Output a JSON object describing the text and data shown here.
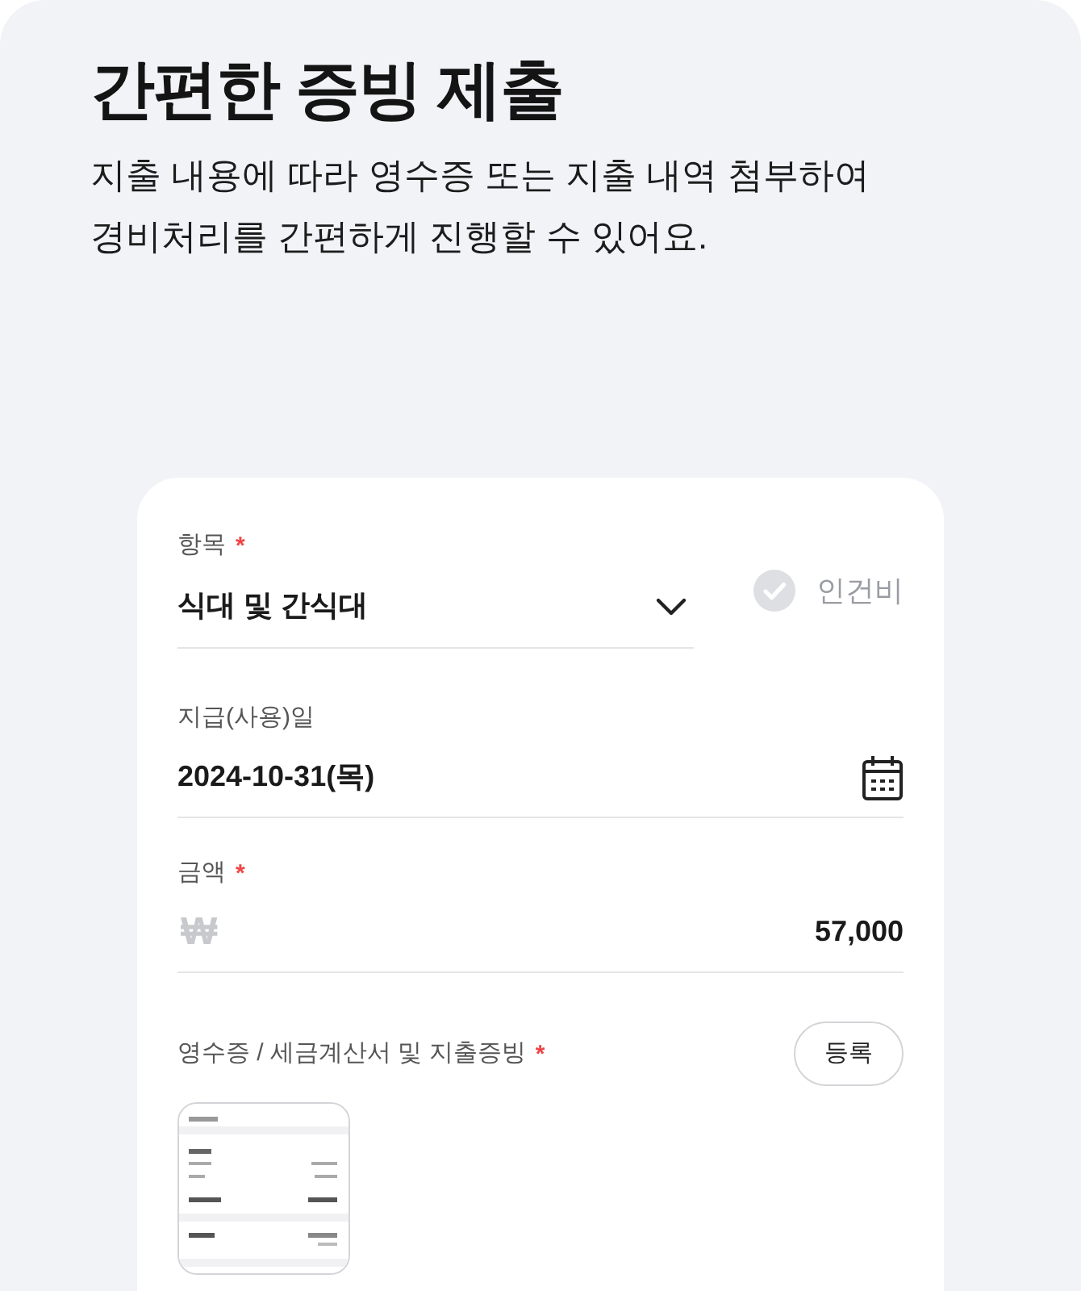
{
  "header": {
    "title": "간편한 증빙 제출",
    "description": "지출 내용에 따라 영수증 또는 지출 내역 첨부하여\n경비처리를 간편하게 진행할 수 있어요."
  },
  "form": {
    "fields": [
      {
        "kind": "select",
        "label": "항목",
        "required_mark": "*",
        "value": "식대 및 간식대",
        "option": {
          "label": "인건비",
          "checked": false
        }
      },
      {
        "kind": "date",
        "label": "지급(사용)일",
        "value": "2024-10-31(목)"
      },
      {
        "kind": "amount",
        "label": "금액",
        "required_mark": "*",
        "currency": "₩",
        "value": "57,000"
      },
      {
        "kind": "attachment",
        "label": "영수증 / 세금계산서 및 지출증빙",
        "required_mark": "*",
        "button": "등록"
      }
    ]
  }
}
